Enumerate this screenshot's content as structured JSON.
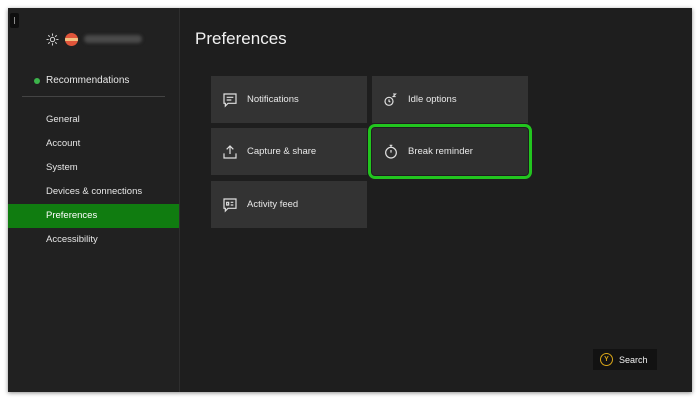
{
  "profile": {
    "gamertag_hidden": true
  },
  "sidebar": {
    "recommendations_label": "Recommendations",
    "items": [
      {
        "label": "General"
      },
      {
        "label": "Account"
      },
      {
        "label": "System"
      },
      {
        "label": "Devices & connections"
      },
      {
        "label": "Preferences",
        "active": true
      },
      {
        "label": "Accessibility"
      }
    ]
  },
  "main": {
    "title": "Preferences",
    "tiles": [
      {
        "label": "Notifications",
        "icon": "notification-icon"
      },
      {
        "label": "Idle options",
        "icon": "idle-icon"
      },
      {
        "label": "Capture & share",
        "icon": "share-icon"
      },
      {
        "label": "Break reminder",
        "icon": "timer-icon",
        "focused": true
      },
      {
        "label": "Activity feed",
        "icon": "activity-feed-icon"
      }
    ]
  },
  "footer": {
    "search_label": "Search",
    "search_button_glyph": "Y"
  },
  "colors": {
    "accent_green": "#107c10",
    "focus_green": "#22c51f",
    "background": "#1e1e1e",
    "tile": "#333333"
  }
}
